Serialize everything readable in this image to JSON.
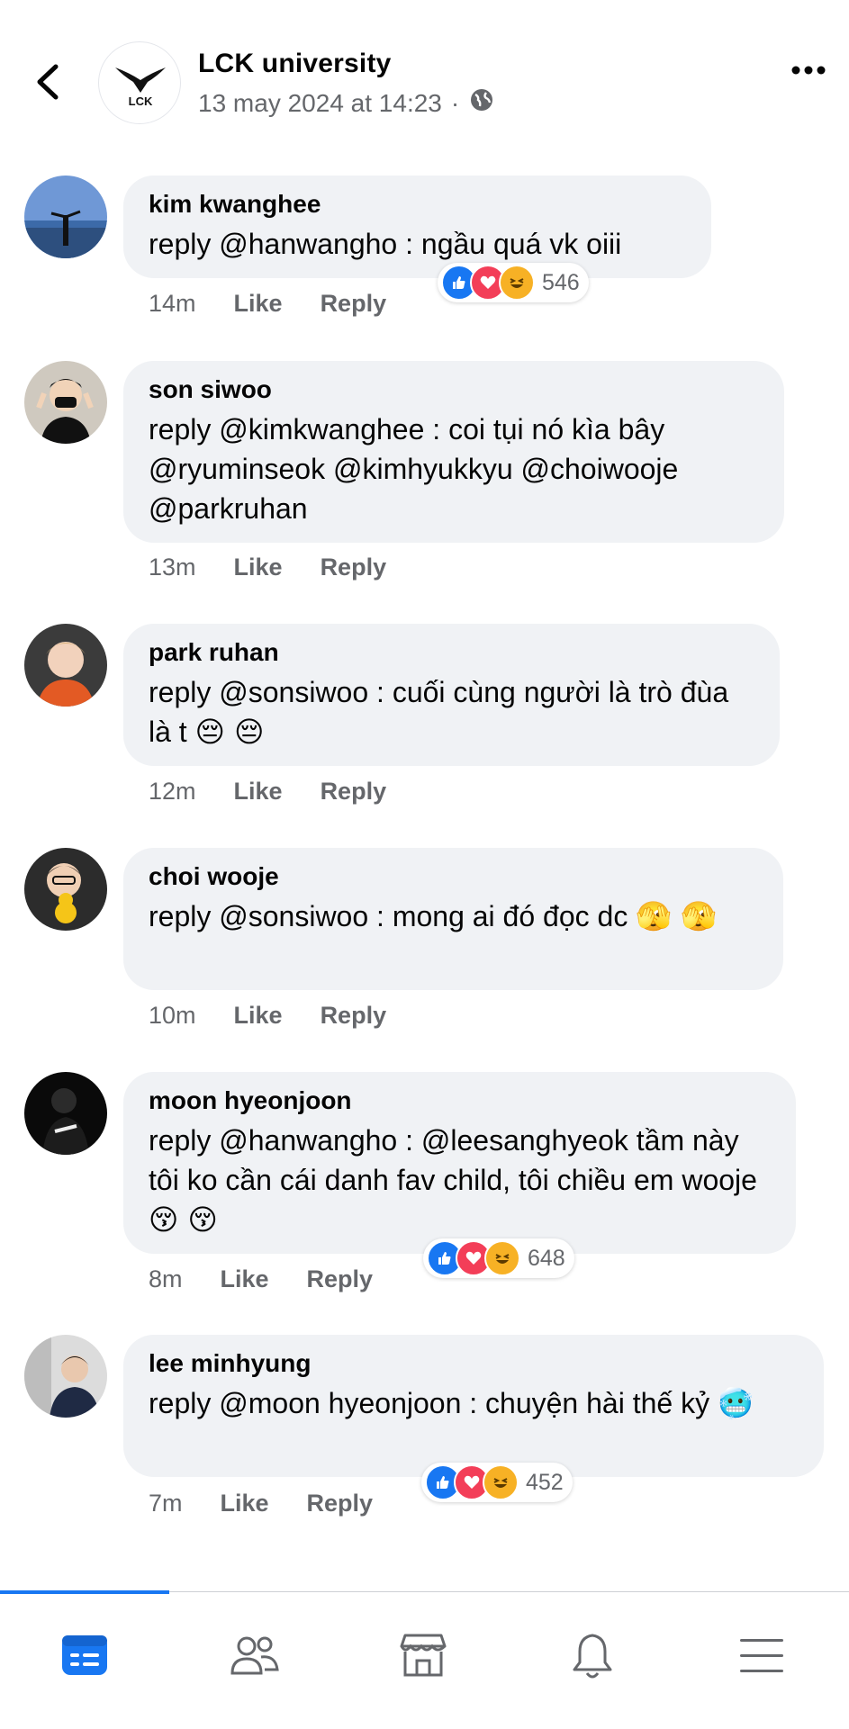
{
  "post": {
    "page_name": "LCK university",
    "timestamp": "13 may 2024 at 14:23",
    "separator": "·",
    "visibility_icon": "globe-icon",
    "logo_text": "LCK"
  },
  "comments": [
    {
      "author": "kim kwanghee",
      "text": "reply @hanwangho : ngầu quá vk oiii",
      "time": "14m",
      "like": "Like",
      "reply": "Reply",
      "reactions": {
        "count": "546"
      }
    },
    {
      "author": "son siwoo",
      "text": "reply @kimkwanghee : coi tụi nó kìa bây @ryuminseok @kimhyukkyu @choiwooje @parkruhan",
      "time": "13m",
      "like": "Like",
      "reply": "Reply"
    },
    {
      "author": "park ruhan",
      "text": "reply @sonsiwoo : cuối cùng người là trò đùa là t",
      "emoji": "😔 😔",
      "time": "12m",
      "like": "Like",
      "reply": "Reply"
    },
    {
      "author": "choi wooje",
      "text": "reply @sonsiwoo : mong ai đó đọc dc",
      "emoji": "🫣 🫣",
      "time": "10m",
      "like": "Like",
      "reply": "Reply"
    },
    {
      "author": "moon hyeonjoon",
      "text": "reply @hanwangho : @leesanghyeok tầm này tôi ko cần cái danh fav child, tôi chiều em wooje",
      "emoji": "😚 😚",
      "time": "8m",
      "like": "Like",
      "reply": "Reply",
      "reactions": {
        "count": "648"
      }
    },
    {
      "author": "lee minhyung",
      "text": "reply @moon hyeonjoon : chuyện hài thế kỷ",
      "emoji": "🥶",
      "time": "7m",
      "like": "Like",
      "reply": "Reply",
      "reactions": {
        "count": "452"
      }
    }
  ],
  "nav": {
    "items": [
      "feed-icon",
      "friends-icon",
      "marketplace-icon",
      "notifications-icon",
      "menu-icon"
    ],
    "active": "feed-icon",
    "accent": "#1877f2"
  }
}
